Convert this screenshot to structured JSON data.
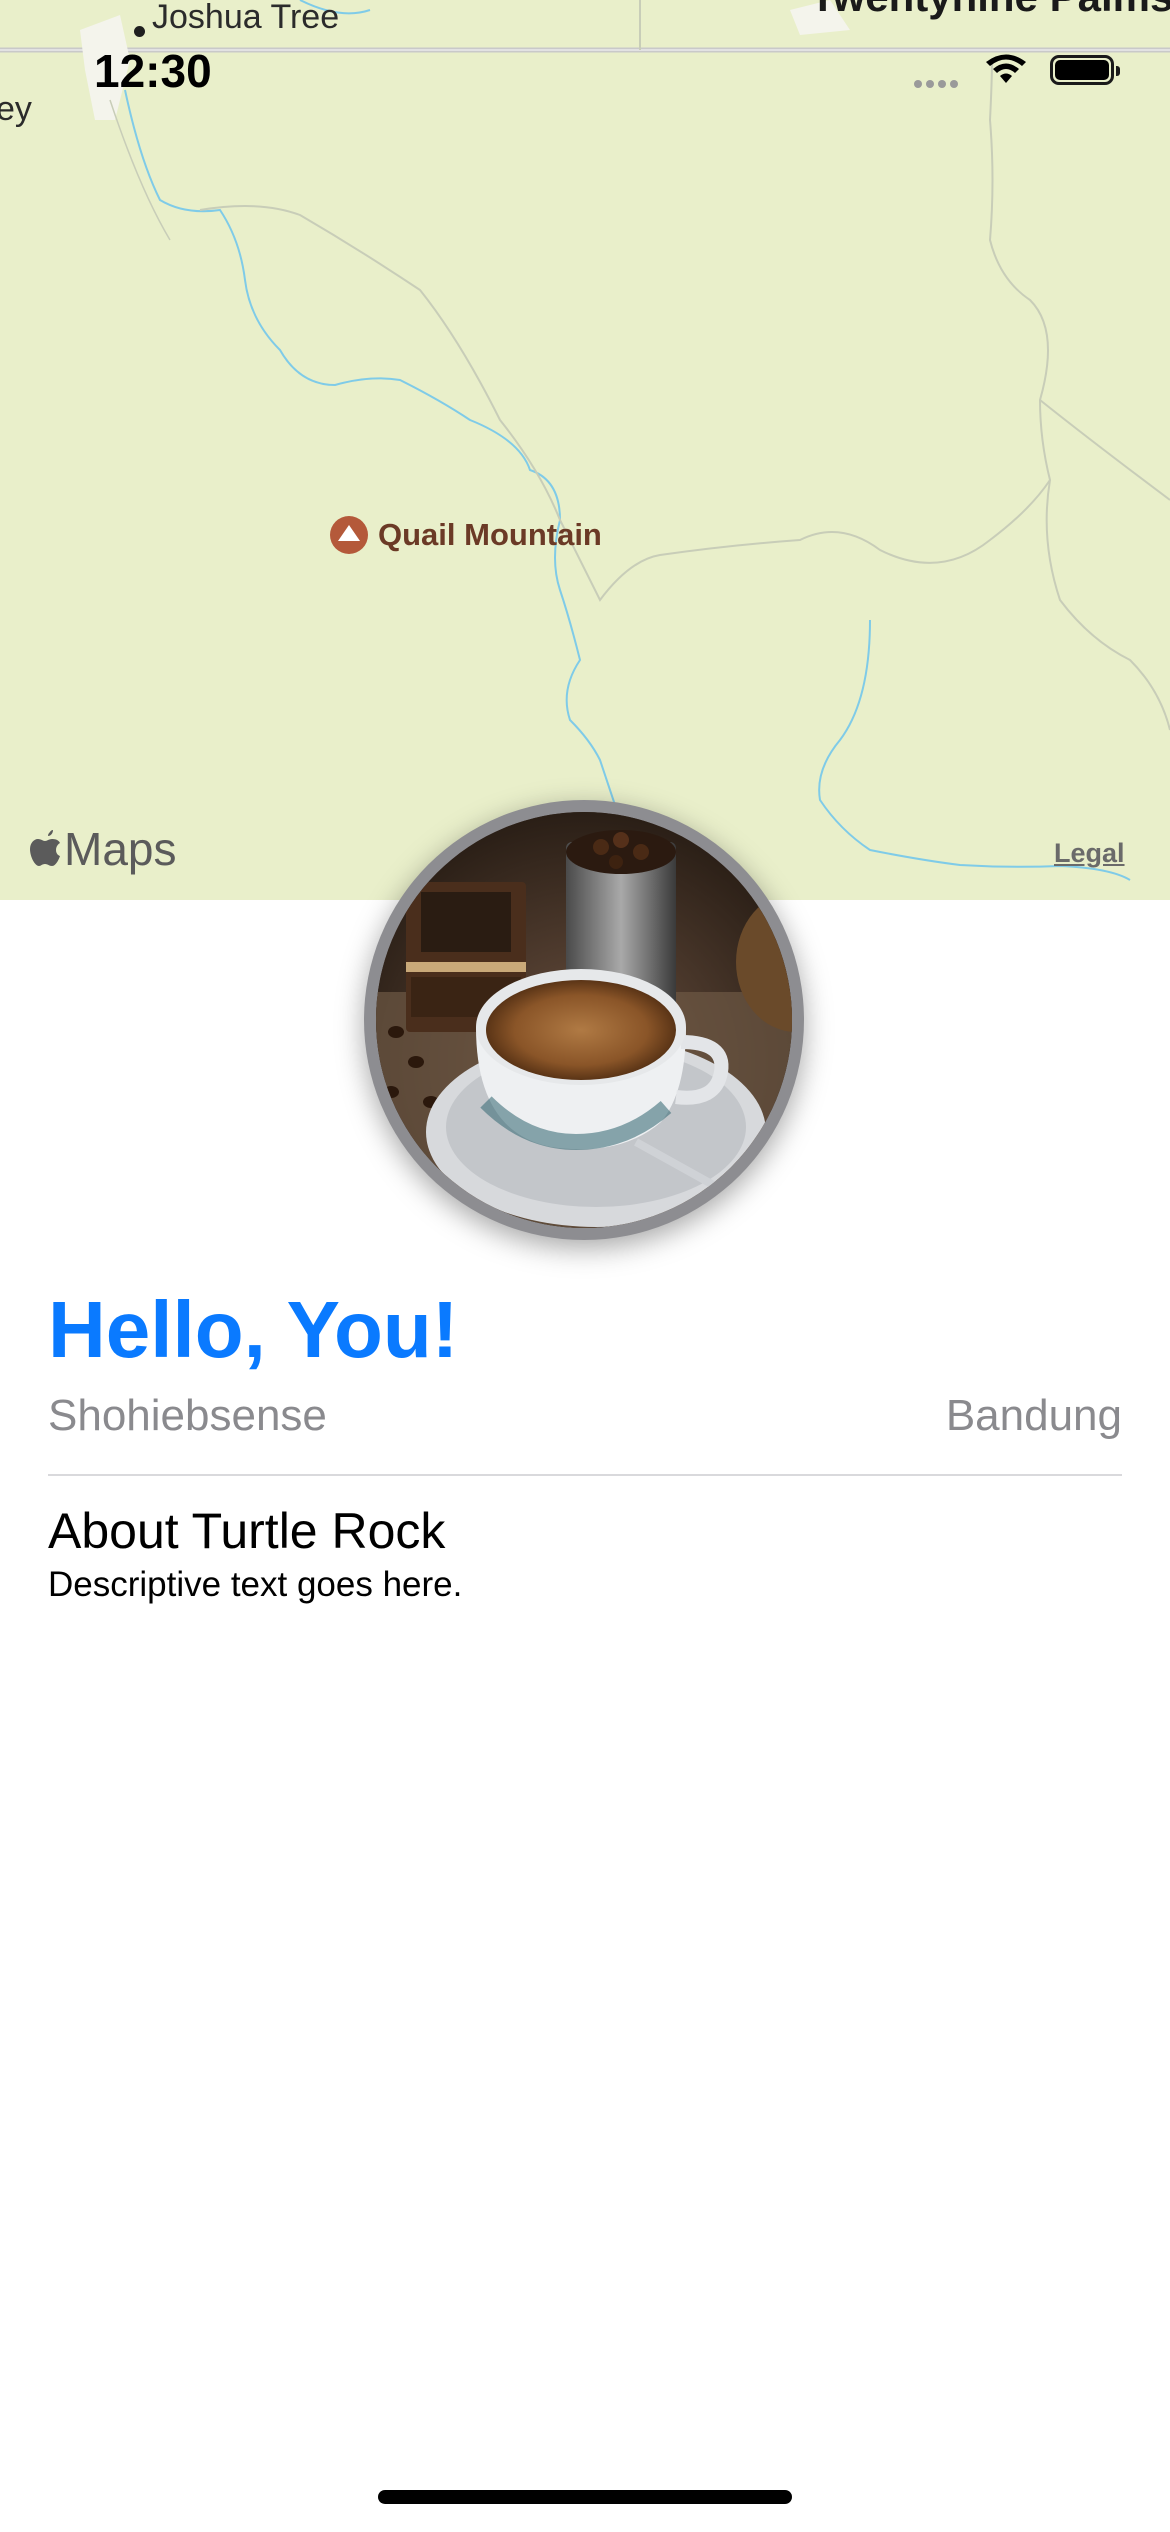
{
  "status_bar": {
    "time": "12:30"
  },
  "map": {
    "places": {
      "joshua_tree": "Joshua Tree",
      "twentynine_palms": "Twentynine Palms",
      "valley_fragment": "ey"
    },
    "poi": {
      "label": "Quail Mountain",
      "icon": "mountain-icon",
      "color": "#b4593a"
    },
    "attribution": {
      "logo_text": "Maps",
      "legal_link": "Legal"
    },
    "background_color": "#e9efca"
  },
  "avatar": {
    "image": "coffee-cup-photo"
  },
  "profile": {
    "title": "Hello, You!",
    "subtitle_left": "Shohiebsense",
    "subtitle_right": "Bandung",
    "title_color": "#0a7aff"
  },
  "about": {
    "heading": "About Turtle Rock",
    "body": "Descriptive text goes here."
  }
}
